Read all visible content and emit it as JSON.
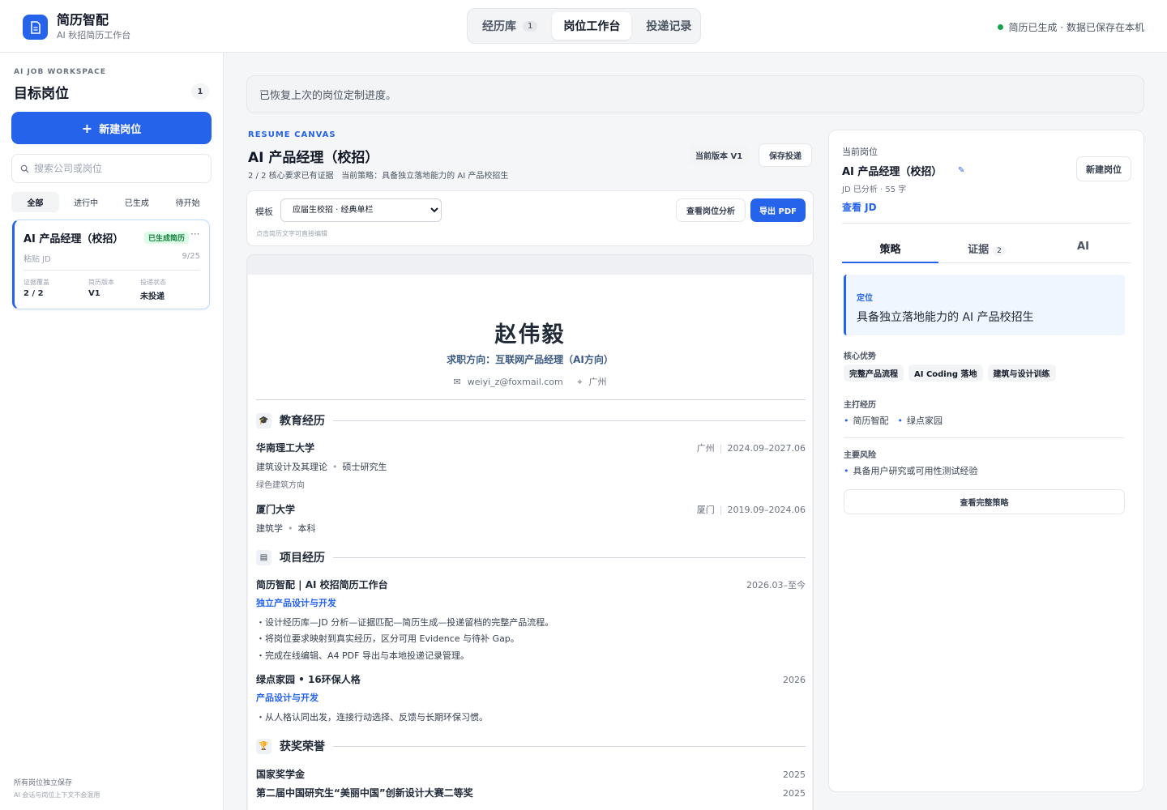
{
  "header": {
    "app_name": "简历智配",
    "app_subtitle": "AI 秋招简历工作台",
    "tabs": [
      {
        "label": "经历库",
        "count": "1"
      },
      {
        "label": "岗位工作台"
      },
      {
        "label": "投递记录"
      }
    ],
    "save_status": "简历已生成 · 数据已保存在本机",
    "colors": {
      "accent": "#2563eb",
      "status_ok": "#16a34a"
    }
  },
  "sidebar": {
    "workspace_label": "AI JOB WORKSPACE",
    "title": "目标岗位",
    "count": "1",
    "new_button": "新建岗位",
    "search_placeholder": "搜索公司或岗位",
    "filters": [
      "全部",
      "进行中",
      "已生成",
      "待开始"
    ],
    "job_card": {
      "title": "AI 产品经理（校招）",
      "badge": "已生成简历",
      "more": "···",
      "source": "粘贴 JD",
      "date": "9/25",
      "stats": [
        {
          "label": "证据覆盖",
          "value": "2 / 2"
        },
        {
          "label": "简历版本",
          "value": "V1"
        },
        {
          "label": "投递状态",
          "value": "未投递"
        }
      ]
    },
    "footer_line1": "所有岗位独立保存",
    "footer_line2": "AI 会话与岗位上下文不会混用"
  },
  "notice": "已恢复上次的岗位定制进度。",
  "canvas": {
    "label": "RESUME CANVAS",
    "title": "AI 产品经理（校招）",
    "coverage": "2 / 2 核心要求已有证据",
    "strategy": "当前策略：具备独立落地能力的 AI 产品校招生",
    "version_badge": "当前版本 V1",
    "save_apply": "保存投递",
    "template_label": "模板",
    "template_selected": "应届生校招 · 经典单栏",
    "analysis_button": "查看岗位分析",
    "export_button": "导出 PDF",
    "edit_hint": "点击简历文字可直接编辑"
  },
  "resume": {
    "name": "赵伟毅",
    "target": "求职方向：互联网产品经理（AI方向）",
    "email": "weiyi_z@foxmail.com",
    "city": "广州",
    "education_title": "教育经历",
    "education": [
      {
        "school": "华南理工大学",
        "location": "广州",
        "period": "2024.09–2027.06",
        "major": "建筑设计及其理论",
        "degree": "硕士研究生",
        "note": "绿色建筑方向"
      },
      {
        "school": "厦门大学",
        "location": "厦门",
        "period": "2019.09–2024.06",
        "major": "建筑学",
        "degree": "本科"
      }
    ],
    "projects_title": "项目经历",
    "projects": [
      {
        "name": "简历智配 | AI 校招简历工作台",
        "period": "2026.03–至今",
        "role": "独立产品设计与开发",
        "bullets": [
          "・设计经历库—JD 分析—证据匹配—简历生成—投递留档的完整产品流程。",
          "・将岗位要求映射到真实经历，区分可用 Evidence 与待补 Gap。",
          "・完成在线编辑、A4 PDF 导出与本地投递记录管理。"
        ]
      },
      {
        "name": "绿点家园 • 16环保人格",
        "period": "2026",
        "role": "产品设计与开发",
        "bullets": [
          "・从人格认同出发，连接行动选择、反馈与长期环保习惯。"
        ]
      }
    ],
    "awards_title": "获奖荣誉",
    "awards": [
      {
        "name": "国家奖学金",
        "year": "2025"
      },
      {
        "name": "第二届中国研究生“美丽中国”创新设计大赛二等奖",
        "year": "2025"
      }
    ]
  },
  "panel": {
    "label": "当前岗位",
    "title": "AI 产品经理（校招）",
    "meta": "JD 已分析 · 55 字",
    "new_job": "新建岗位",
    "view_jd": "查看 JD",
    "tabs": [
      {
        "label": "策略"
      },
      {
        "label": "证据",
        "count": "2"
      },
      {
        "label": "AI"
      }
    ],
    "positioning_label": "定位",
    "positioning_value": "具备独立落地能力的 AI 产品校招生",
    "advantages_label": "核心优势",
    "advantages": [
      "完整产品流程",
      "AI Coding 落地",
      "建筑与设计训练"
    ],
    "main_exp_label": "主打经历",
    "main_exp": [
      "简历智配",
      "绿点家园"
    ],
    "risk_label": "主要风险",
    "risks": [
      "具备用户研究或可用性测试经验"
    ],
    "full_strategy": "查看完整策略"
  }
}
